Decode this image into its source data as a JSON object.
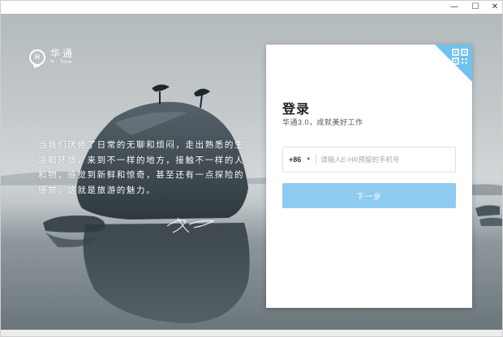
{
  "window": {
    "minimize_glyph": "—",
    "maximize_glyph": "☐",
    "close_glyph": "✕"
  },
  "brand": {
    "mark_letter": "H",
    "name_cn": "华通",
    "name_en": "H - Tone"
  },
  "quote": "当我们厌倦了日常的无聊和烦闷，走出熟悉的生活和环境，来到不一样的地方，接触不一样的人和物，感觉到新鲜和惊奇，甚至还有一点探险的感觉，这就是旅游的魅力。",
  "login": {
    "title": "登录",
    "subtitle": "华通3.0，成就美好工作",
    "country_code": "+86",
    "caret": "▼",
    "phone_placeholder": "请输入E-HR预留的手机号",
    "phone_value": "",
    "next_label": "下一步",
    "qr_icon": "qr-code-icon"
  },
  "colors": {
    "accent": "#8ecbf0",
    "corner_blue": "#6fc1ee"
  }
}
